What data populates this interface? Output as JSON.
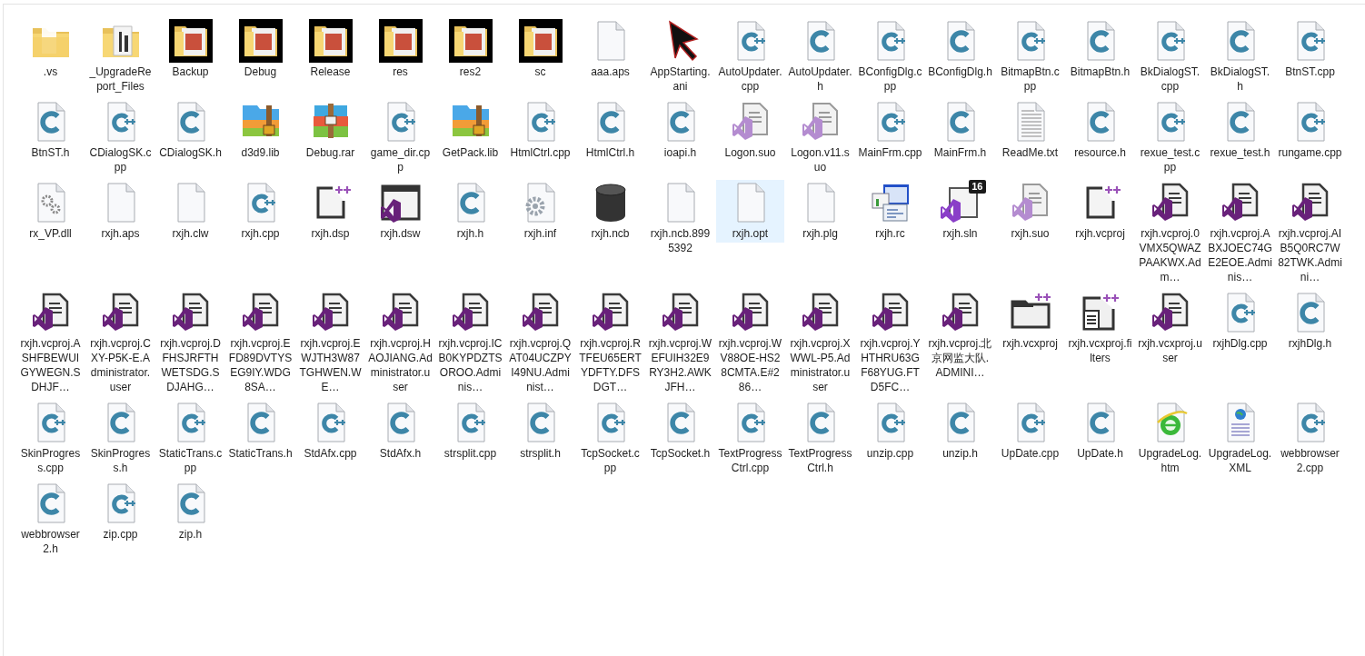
{
  "items": [
    {
      "name": ".vs",
      "kind": "folder",
      "selected": false
    },
    {
      "name": "_UpgradeReport_Files",
      "kind": "folder-doc",
      "selected": false
    },
    {
      "name": "Backup",
      "kind": "folder-thumb",
      "selected": false
    },
    {
      "name": "Debug",
      "kind": "folder-thumb",
      "selected": false
    },
    {
      "name": "Release",
      "kind": "folder-thumb",
      "selected": false
    },
    {
      "name": "res",
      "kind": "folder-thumb",
      "selected": false
    },
    {
      "name": "res2",
      "kind": "folder-thumb",
      "selected": false
    },
    {
      "name": "sc",
      "kind": "folder-thumb",
      "selected": false
    },
    {
      "name": "aaa.aps",
      "kind": "blank",
      "selected": false
    },
    {
      "name": "AppStarting.ani",
      "kind": "cursor",
      "selected": false
    },
    {
      "name": "AutoUpdater.cpp",
      "kind": "cpp",
      "selected": false
    },
    {
      "name": "AutoUpdater.h",
      "kind": "h",
      "selected": false
    },
    {
      "name": "BConfigDlg.cpp",
      "kind": "cpp",
      "selected": false
    },
    {
      "name": "BConfigDlg.h",
      "kind": "h",
      "selected": false
    },
    {
      "name": "BitmapBtn.cpp",
      "kind": "cpp",
      "selected": false
    },
    {
      "name": "BitmapBtn.h",
      "kind": "h",
      "selected": false
    },
    {
      "name": "BkDialogST.cpp",
      "kind": "cpp",
      "selected": false
    },
    {
      "name": "BkDialogST.h",
      "kind": "h",
      "selected": false
    },
    {
      "name": "BtnST.cpp",
      "kind": "cpp",
      "selected": false
    },
    {
      "name": "BtnST.h",
      "kind": "h",
      "selected": false
    },
    {
      "name": "CDialogSK.cpp",
      "kind": "cpp",
      "selected": false
    },
    {
      "name": "CDialogSK.h",
      "kind": "h",
      "selected": false
    },
    {
      "name": "d3d9.lib",
      "kind": "zip",
      "selected": false
    },
    {
      "name": "Debug.rar",
      "kind": "rar",
      "selected": false
    },
    {
      "name": "game_dir.cpp",
      "kind": "cpp",
      "selected": false
    },
    {
      "name": "GetPack.lib",
      "kind": "zip",
      "selected": false
    },
    {
      "name": "HtmlCtrl.cpp",
      "kind": "cpp",
      "selected": false
    },
    {
      "name": "HtmlCtrl.h",
      "kind": "h",
      "selected": false
    },
    {
      "name": "ioapi.h",
      "kind": "h",
      "selected": false
    },
    {
      "name": "Logon.suo",
      "kind": "suo",
      "selected": false
    },
    {
      "name": "Logon.v11.suo",
      "kind": "suo",
      "selected": false
    },
    {
      "name": "MainFrm.cpp",
      "kind": "cpp",
      "selected": false
    },
    {
      "name": "MainFrm.h",
      "kind": "h",
      "selected": false
    },
    {
      "name": "ReadMe.txt",
      "kind": "txt",
      "selected": false
    },
    {
      "name": "resource.h",
      "kind": "h",
      "selected": false
    },
    {
      "name": "rexue_test.cpp",
      "kind": "cpp",
      "selected": false
    },
    {
      "name": "rexue_test.h",
      "kind": "h",
      "selected": false
    },
    {
      "name": "rungame.cpp",
      "kind": "cpp",
      "selected": false
    },
    {
      "name": "rx_VP.dll",
      "kind": "dll",
      "selected": false
    },
    {
      "name": "rxjh.aps",
      "kind": "blank",
      "selected": false
    },
    {
      "name": "rxjh.clw",
      "kind": "blank",
      "selected": false
    },
    {
      "name": "rxjh.cpp",
      "kind": "cpp",
      "selected": false
    },
    {
      "name": "rxjh.dsp",
      "kind": "project",
      "selected": false
    },
    {
      "name": "rxjh.dsw",
      "kind": "dsw",
      "selected": false
    },
    {
      "name": "rxjh.h",
      "kind": "h",
      "selected": false
    },
    {
      "name": "rxjh.inf",
      "kind": "inf",
      "selected": false
    },
    {
      "name": "rxjh.ncb",
      "kind": "ncb",
      "selected": false
    },
    {
      "name": "rxjh.ncb.8995392",
      "kind": "blank",
      "selected": false
    },
    {
      "name": "rxjh.opt",
      "kind": "blank",
      "selected": true
    },
    {
      "name": "rxjh.plg",
      "kind": "blank",
      "selected": false
    },
    {
      "name": "rxjh.rc",
      "kind": "rc",
      "selected": false
    },
    {
      "name": "rxjh.sln",
      "kind": "sln",
      "badge": "16",
      "selected": false
    },
    {
      "name": "rxjh.suo",
      "kind": "suo",
      "selected": false
    },
    {
      "name": "rxjh.vcproj",
      "kind": "project",
      "selected": false
    },
    {
      "name": "rxjh.vcproj.0VMX5QWAZPAAKWX.Adm…",
      "kind": "user",
      "selected": false
    },
    {
      "name": "rxjh.vcproj.ABXJOEC74GE2EOE.Adminis…",
      "kind": "user",
      "selected": false
    },
    {
      "name": "rxjh.vcproj.AIB5Q0RC7W82TWK.Admini…",
      "kind": "user",
      "selected": false
    },
    {
      "name": "rxjh.vcproj.ASHFBEWUIGYWEGN.SDHJF…",
      "kind": "user",
      "selected": false
    },
    {
      "name": "rxjh.vcproj.CXY-P5K-E.Administrator.user",
      "kind": "user",
      "selected": false
    },
    {
      "name": "rxjh.vcproj.DFHSJRFTHWETSDG.SDJAHG…",
      "kind": "user",
      "selected": false
    },
    {
      "name": "rxjh.vcproj.EFD89DVTYSEG9IY.WDG8SA…",
      "kind": "user",
      "selected": false
    },
    {
      "name": "rxjh.vcproj.EWJTH3W87TGHWEN.WE…",
      "kind": "user",
      "selected": false
    },
    {
      "name": "rxjh.vcproj.HAOJIANG.Administrator.user",
      "kind": "user",
      "selected": false
    },
    {
      "name": "rxjh.vcproj.ICB0KYPDZTSOROO.Adminis…",
      "kind": "user",
      "selected": false
    },
    {
      "name": "rxjh.vcproj.QAT04UCZPYI49NU.Administ…",
      "kind": "user",
      "selected": false
    },
    {
      "name": "rxjh.vcproj.RTFEU65ERTYDFTY.DFSDGT…",
      "kind": "user",
      "selected": false
    },
    {
      "name": "rxjh.vcproj.WEFUIH32E9RY3H2.AWKJFH…",
      "kind": "user",
      "selected": false
    },
    {
      "name": "rxjh.vcproj.WV88OE-HS28CMTA.E#286…",
      "kind": "user",
      "selected": false
    },
    {
      "name": "rxjh.vcproj.XWWL-P5.Administrator.user",
      "kind": "user",
      "selected": false
    },
    {
      "name": "rxjh.vcproj.YHTHRU63GF68YUG.FTD5FC…",
      "kind": "user",
      "selected": false
    },
    {
      "name": "rxjh.vcproj.北京网监大队.ADMINI…",
      "kind": "user",
      "selected": false
    },
    {
      "name": "rxjh.vcxproj",
      "kind": "vcxproj",
      "selected": false
    },
    {
      "name": "rxjh.vcxproj.filters",
      "kind": "filters",
      "selected": false
    },
    {
      "name": "rxjh.vcxproj.user",
      "kind": "user",
      "selected": false
    },
    {
      "name": "rxjhDlg.cpp",
      "kind": "cpp",
      "selected": false
    },
    {
      "name": "rxjhDlg.h",
      "kind": "h",
      "selected": false
    },
    {
      "name": "SkinProgress.cpp",
      "kind": "cpp",
      "selected": false
    },
    {
      "name": "SkinProgress.h",
      "kind": "h",
      "selected": false
    },
    {
      "name": "StaticTrans.cpp",
      "kind": "cpp",
      "selected": false
    },
    {
      "name": "StaticTrans.h",
      "kind": "h",
      "selected": false
    },
    {
      "name": "StdAfx.cpp",
      "kind": "cpp",
      "selected": false
    },
    {
      "name": "StdAfx.h",
      "kind": "h",
      "selected": false
    },
    {
      "name": "strsplit.cpp",
      "kind": "cpp",
      "selected": false
    },
    {
      "name": "strsplit.h",
      "kind": "h",
      "selected": false
    },
    {
      "name": "TcpSocket.cpp",
      "kind": "cpp",
      "selected": false
    },
    {
      "name": "TcpSocket.h",
      "kind": "h",
      "selected": false
    },
    {
      "name": "TextProgressCtrl.cpp",
      "kind": "cpp",
      "selected": false
    },
    {
      "name": "TextProgressCtrl.h",
      "kind": "h",
      "selected": false
    },
    {
      "name": "unzip.cpp",
      "kind": "cpp",
      "selected": false
    },
    {
      "name": "unzip.h",
      "kind": "h",
      "selected": false
    },
    {
      "name": "UpDate.cpp",
      "kind": "cpp",
      "selected": false
    },
    {
      "name": "UpDate.h",
      "kind": "h",
      "selected": false
    },
    {
      "name": "UpgradeLog.htm",
      "kind": "htm",
      "selected": false
    },
    {
      "name": "UpgradeLog.XML",
      "kind": "xml",
      "selected": false
    },
    {
      "name": "webbrowser2.cpp",
      "kind": "cpp",
      "selected": false
    },
    {
      "name": "webbrowser2.h",
      "kind": "h",
      "selected": false
    },
    {
      "name": "zip.cpp",
      "kind": "cpp",
      "selected": false
    },
    {
      "name": "zip.h",
      "kind": "h",
      "selected": false
    }
  ]
}
